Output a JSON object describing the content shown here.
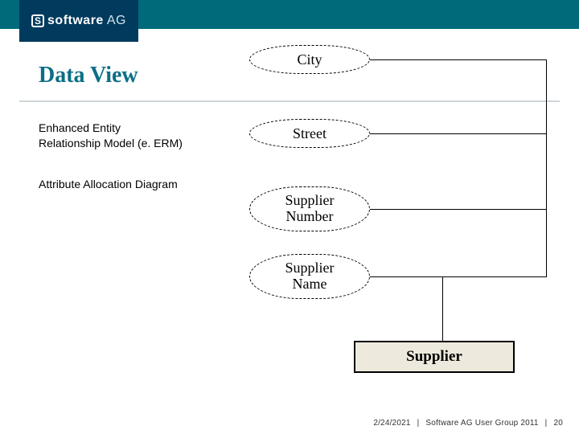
{
  "brand": {
    "bold": "software",
    "light": "AG",
    "glyph": "S"
  },
  "title": "Data View",
  "body": {
    "model_name": "Enhanced Entity Relationship Model (e. ERM)",
    "diagram_type": "Attribute Allocation Diagram"
  },
  "diagram": {
    "attributes": {
      "city": "City",
      "street": "Street",
      "supplier_number_l1": "Supplier",
      "supplier_number_l2": "Number",
      "supplier_name_l1": "Supplier",
      "supplier_name_l2": "Name"
    },
    "entity": "Supplier"
  },
  "footer": {
    "date": "2/24/2021",
    "event": "Software AG User Group 2011",
    "page": "20"
  }
}
